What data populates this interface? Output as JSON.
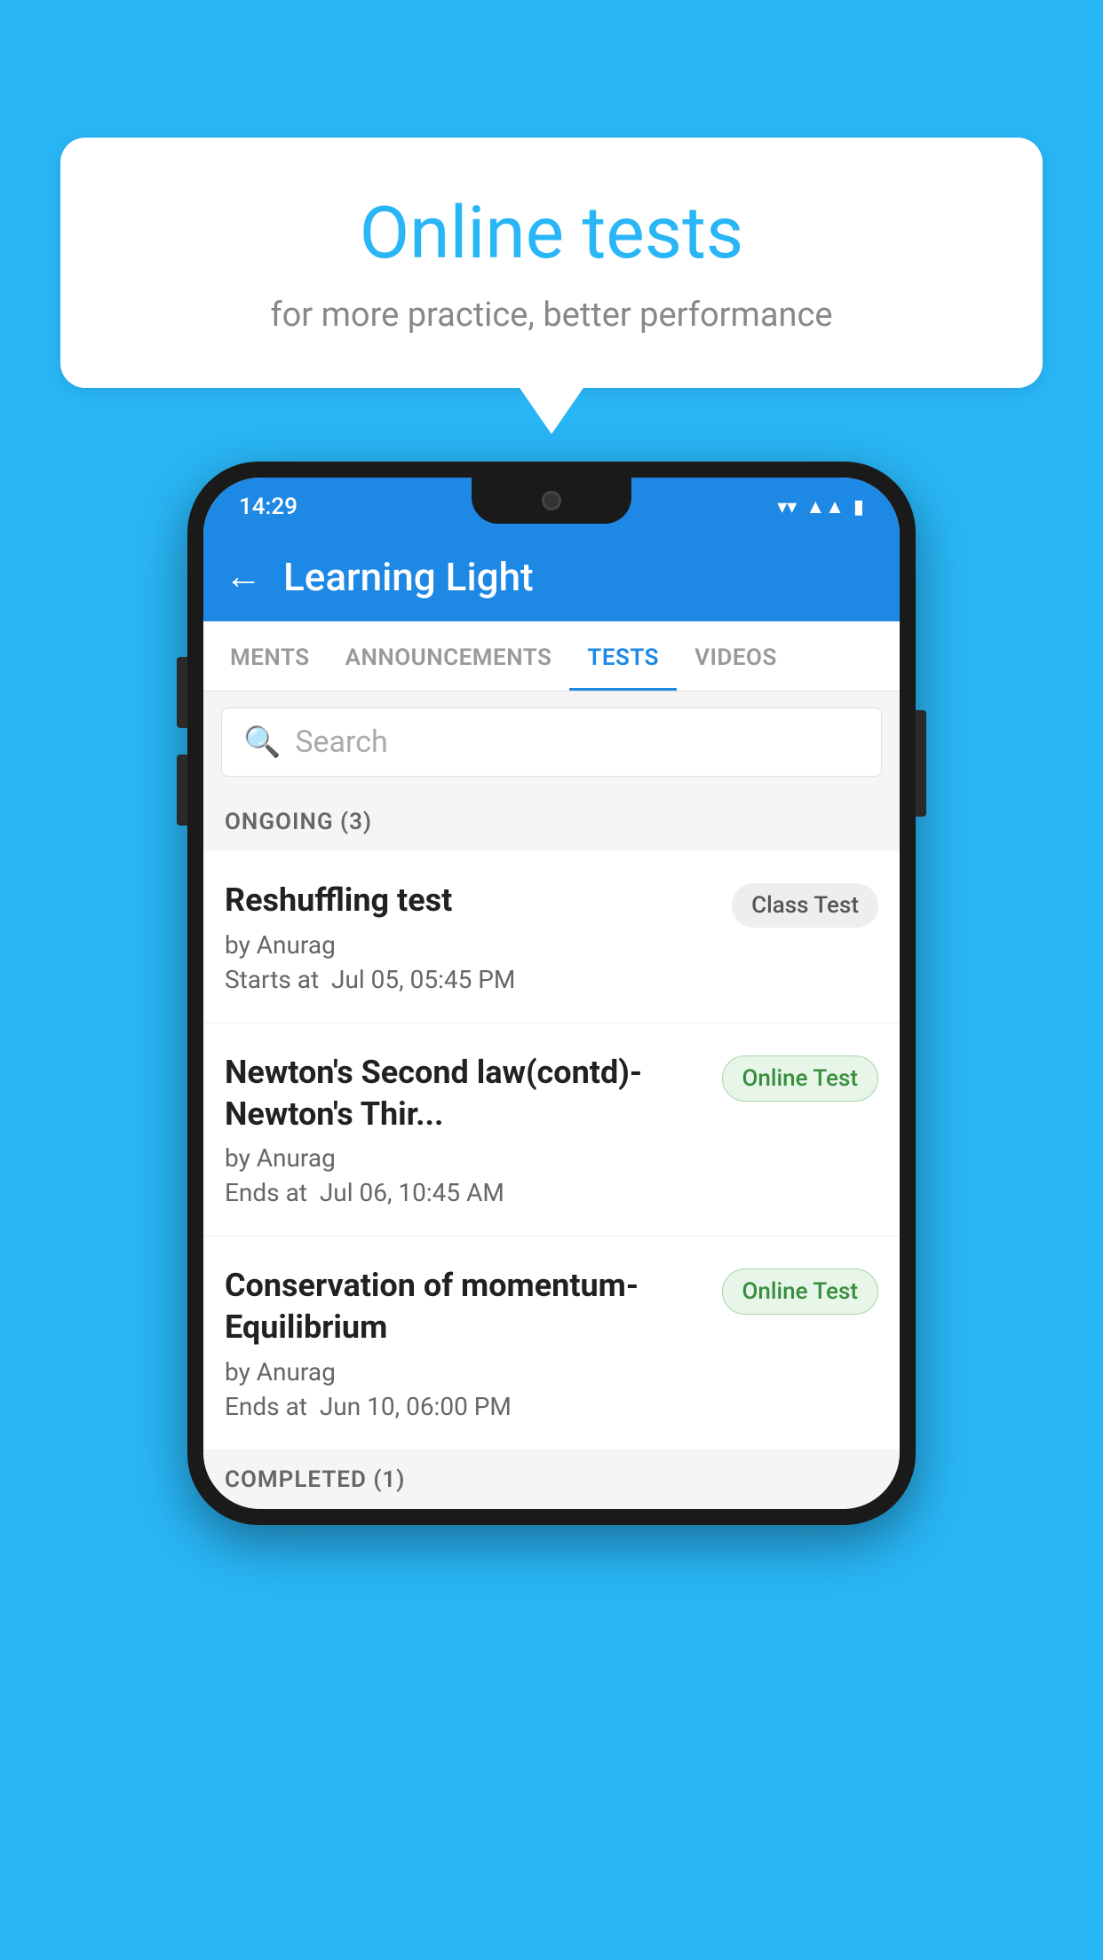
{
  "background": {
    "color": "#29B6F6"
  },
  "speech_bubble": {
    "title": "Online tests",
    "subtitle": "for more practice, better performance"
  },
  "phone": {
    "status_bar": {
      "time": "14:29",
      "wifi": "▼",
      "signal": "◀",
      "battery": "▮"
    },
    "header": {
      "back_label": "←",
      "title": "Learning Light"
    },
    "tabs": [
      {
        "label": "MENTS",
        "active": false
      },
      {
        "label": "ANNOUNCEMENTS",
        "active": false
      },
      {
        "label": "TESTS",
        "active": true
      },
      {
        "label": "VIDEOS",
        "active": false
      }
    ],
    "search": {
      "placeholder": "Search"
    },
    "ongoing_section": {
      "label": "ONGOING (3)"
    },
    "tests": [
      {
        "name": "Reshuffling test",
        "author": "by Anurag",
        "date_label": "Starts at",
        "date": "Jul 05, 05:45 PM",
        "badge": "Class Test",
        "badge_type": "class"
      },
      {
        "name": "Newton's Second law(contd)-Newton's Thir...",
        "author": "by Anurag",
        "date_label": "Ends at",
        "date": "Jul 06, 10:45 AM",
        "badge": "Online Test",
        "badge_type": "online"
      },
      {
        "name": "Conservation of momentum-Equilibrium",
        "author": "by Anurag",
        "date_label": "Ends at",
        "date": "Jun 10, 06:00 PM",
        "badge": "Online Test",
        "badge_type": "online"
      }
    ],
    "completed_section": {
      "label": "COMPLETED (1)"
    }
  }
}
